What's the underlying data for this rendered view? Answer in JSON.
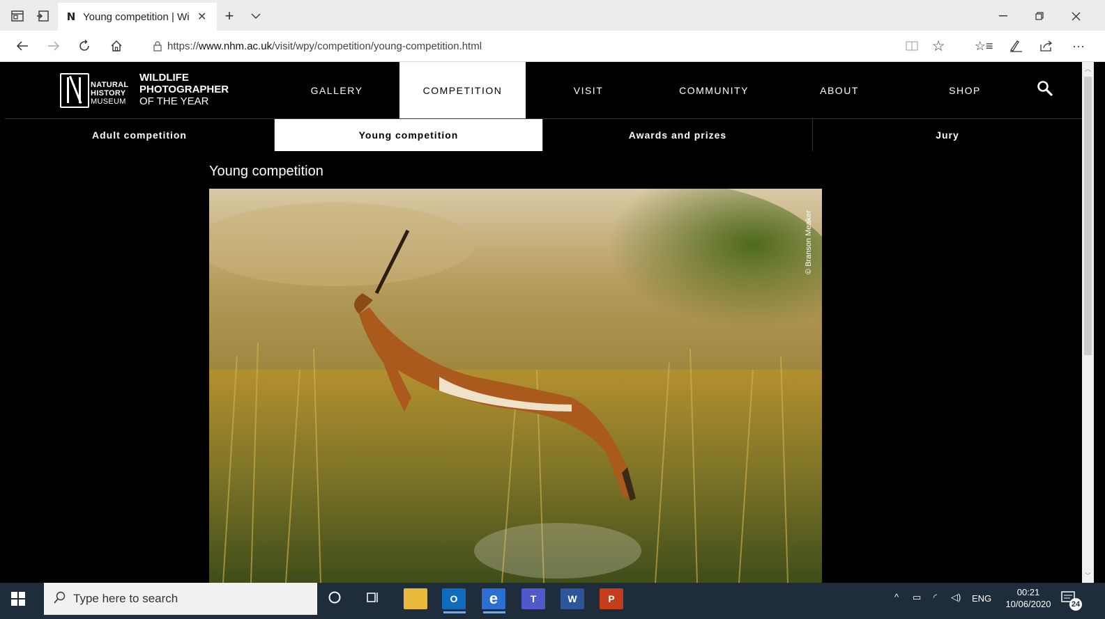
{
  "browser": {
    "tab_title": "Young competition | Wi",
    "url_prefix": "https://",
    "url_host": "www.nhm.ac.uk",
    "url_path": "/visit/wpy/competition/young-competition.html",
    "tab_favicon": "N"
  },
  "site": {
    "logo": {
      "nhm_line1": "NATURAL",
      "nhm_line2": "HISTORY",
      "nhm_line3": "MUSEUM",
      "wpy_line1": "WILDLIFE",
      "wpy_line2": "PHOTOGRAPHER",
      "wpy_line3": "OF THE YEAR"
    },
    "main_nav": [
      {
        "label": "GALLERY",
        "active": false
      },
      {
        "label": "COMPETITION",
        "active": true
      },
      {
        "label": "VISIT",
        "active": false
      },
      {
        "label": "COMMUNITY",
        "active": false
      },
      {
        "label": "ABOUT",
        "active": false
      },
      {
        "label": "SHOP",
        "active": false
      }
    ],
    "sub_nav": [
      {
        "label": "Adult competition",
        "active": false
      },
      {
        "label": "Young competition",
        "active": true
      },
      {
        "label": "Awards and prizes",
        "active": false
      },
      {
        "label": "Jury",
        "active": false
      }
    ],
    "page_title": "Young competition",
    "photo_credit": "© Branson Meaker"
  },
  "taskbar": {
    "search_placeholder": "Type here to search",
    "language": "ENG",
    "time": "00:21",
    "date": "10/06/2020",
    "notification_count": "24"
  },
  "colors": {
    "site_bg": "#000000",
    "taskbar_bg": "#1f2c3b",
    "chrome_bg": "#ececec"
  }
}
